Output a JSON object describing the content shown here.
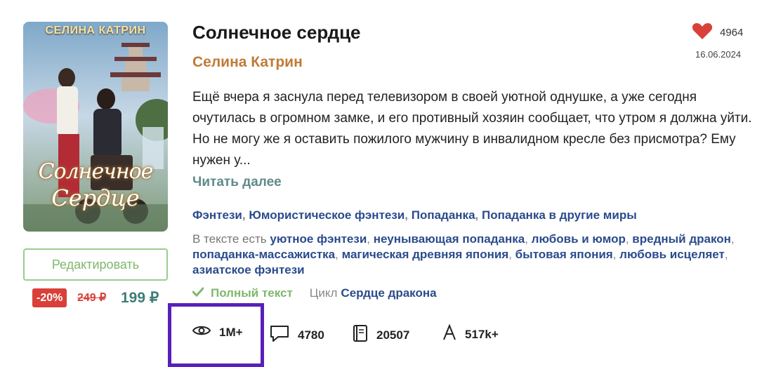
{
  "book": {
    "cover_author": "СЕЛИНА КАТРИН",
    "cover_title_line1": "Солнечное",
    "cover_title_line2": "Сердце",
    "title": "Солнечное сердце",
    "author": "Селина Катрин",
    "likes": "4964",
    "date": "16.06.2024",
    "description": "Ещё вчера я заснула перед телевизором в своей уютной однушке, а уже сегодня очутилась в огромном замке, и его противный хозяин сообщает, что утром я должна уйти. Но не могу же я оставить пожилого мужчину в инвалидном кресле без присмотра? Ему нужен у...",
    "read_more": "Читать далее"
  },
  "genres": [
    "Фэнтези",
    "Юмористическое фэнтези",
    "Попаданка",
    "Попаданка в другие миры"
  ],
  "tags_prefix": "В тексте есть",
  "tags": [
    "уютное фэнтези",
    "неунывающая попаданка",
    "любовь и юмор",
    "вредный дракон",
    "попаданка-массажистка",
    "магическая древняя япония",
    "бытовая япония",
    "любовь исцеляет",
    "азиатское фэнтези"
  ],
  "status": {
    "full_text": "Полный текст",
    "cycle_label": "Цикл",
    "cycle_name": "Сердце дракона"
  },
  "purchase": {
    "edit_button": "Редактировать",
    "discount": "-20%",
    "old_price": "249 ₽",
    "new_price": "199 ₽"
  },
  "stats": {
    "views": "1M+",
    "comments": "4780",
    "pages": "20507",
    "characters": "517k+"
  },
  "colors": {
    "accent_green": "#7fb76c",
    "author_orange": "#c07a37",
    "link_blue": "#2a4b8c",
    "discount_red": "#d9403a",
    "price_teal": "#3e7c78",
    "highlight_purple": "#5a1fb8"
  },
  "icons": [
    "heart-icon",
    "check-icon",
    "eye-icon",
    "comment-icon",
    "book-icon",
    "font-icon"
  ]
}
